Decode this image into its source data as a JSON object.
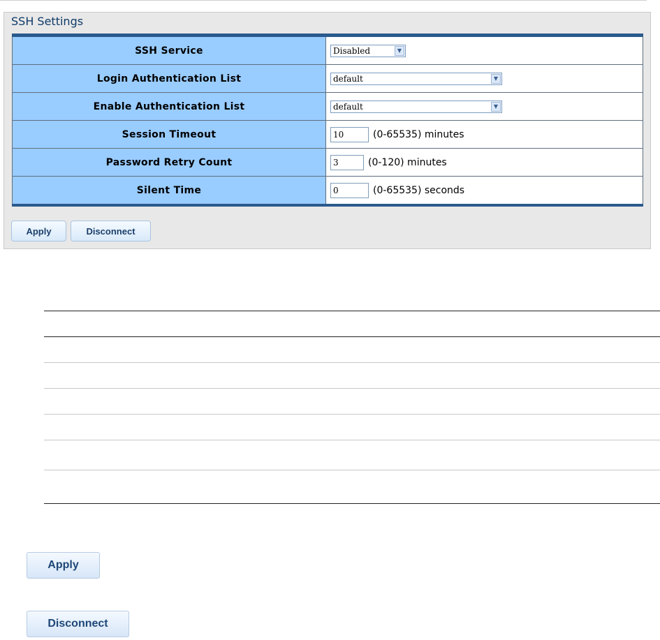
{
  "panel": {
    "title": "SSH Settings",
    "rows": [
      {
        "label": "SSH Service",
        "value": "Disabled"
      },
      {
        "label": "Login Authentication List",
        "value": "default"
      },
      {
        "label": "Enable Authentication List",
        "value": "default"
      },
      {
        "label": "Session Timeout",
        "value": "10",
        "hint": "(0-65535) minutes"
      },
      {
        "label": "Password Retry Count",
        "value": "3",
        "hint": "(0-120) minutes"
      },
      {
        "label": "Silent Time",
        "value": "0",
        "hint": "(0-65535) seconds"
      }
    ],
    "apply_label": "Apply",
    "disconnect_label": "Disconnect"
  },
  "icons": {
    "dropdown": "chevron-down-icon"
  },
  "colors": {
    "label_bg": "#99ccff",
    "accent": "#2a5a8c",
    "panel_bg": "#e8e8e8"
  },
  "lower": {
    "apply_label": "Apply",
    "disconnect_label": "Disconnect"
  }
}
